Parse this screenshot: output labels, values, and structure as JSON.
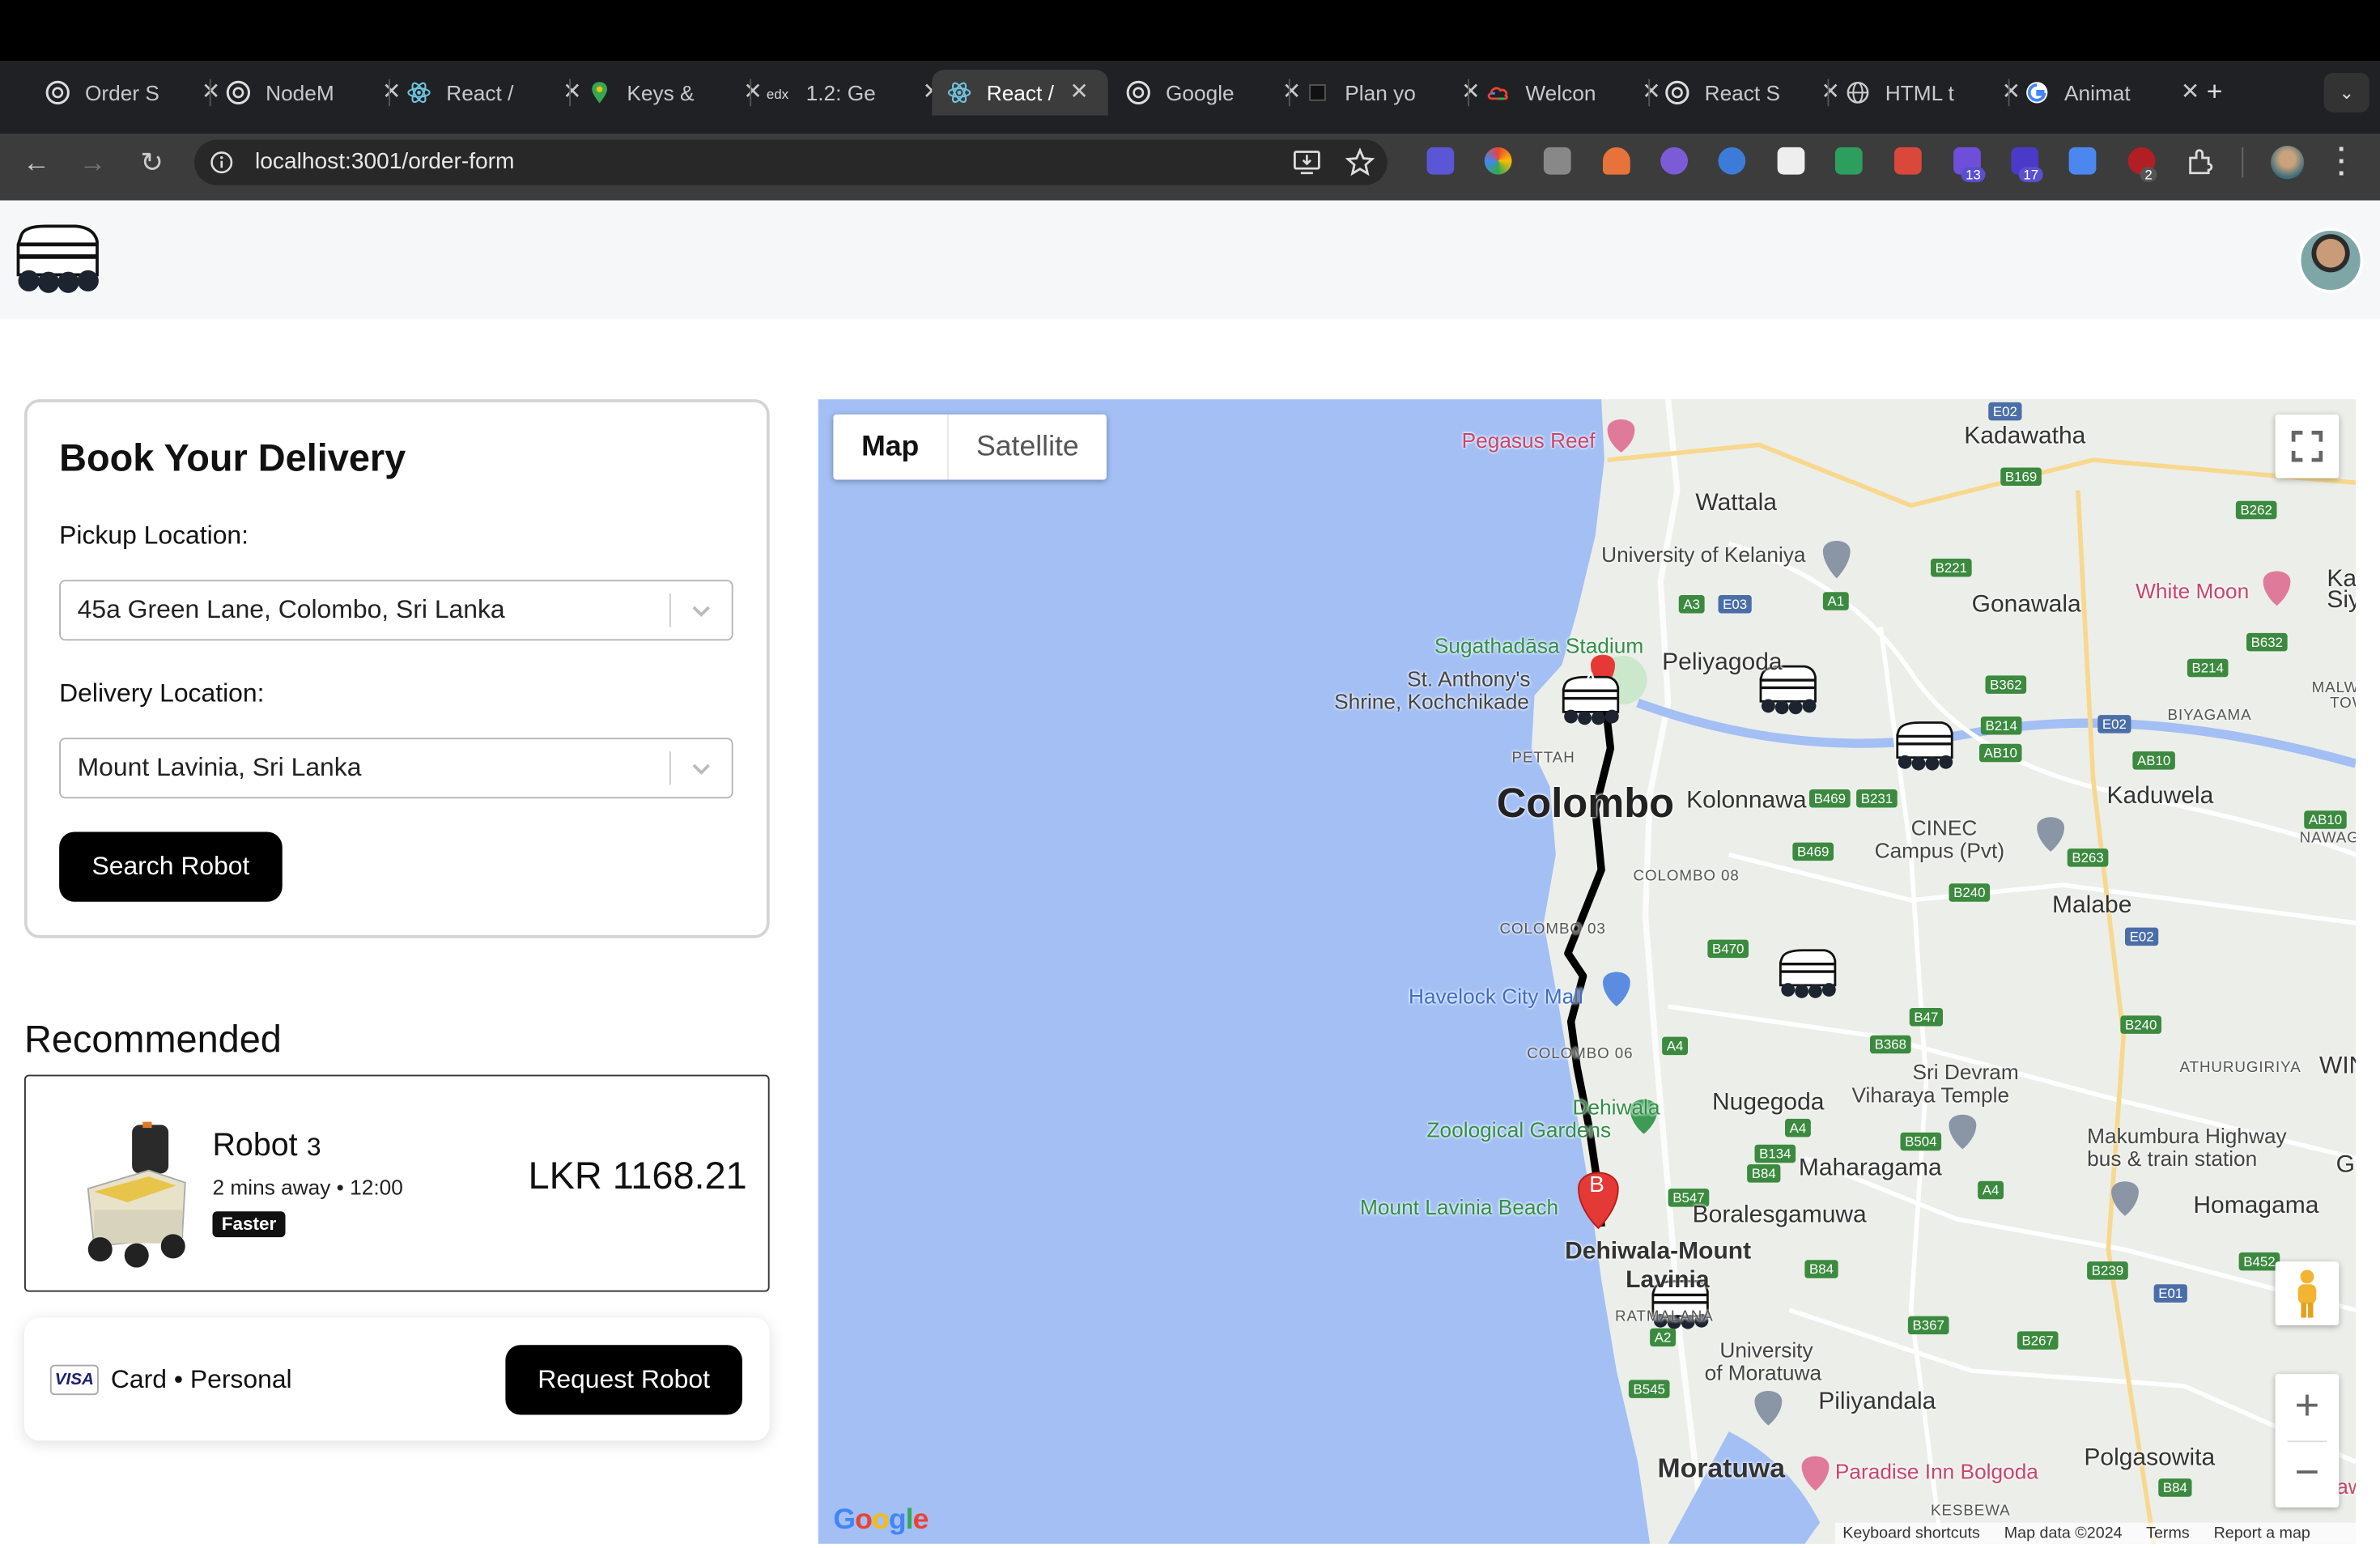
{
  "browser": {
    "tabs": [
      {
        "label": "Order S",
        "icon": "openai-icon",
        "active": false
      },
      {
        "label": "NodeM",
        "icon": "openai-icon",
        "active": false
      },
      {
        "label": "React /",
        "icon": "react-icon",
        "active": false
      },
      {
        "label": "Keys &",
        "icon": "maps-pin-icon",
        "active": false
      },
      {
        "label": "1.2: Ge",
        "icon": "edx-icon",
        "active": false
      },
      {
        "label": "React /",
        "icon": "react-icon",
        "active": true
      },
      {
        "label": "Google",
        "icon": "openai-icon",
        "active": false
      },
      {
        "label": "Plan yo",
        "icon": "notion-icon",
        "active": false
      },
      {
        "label": "Welcon",
        "icon": "cloud-icon",
        "active": false
      },
      {
        "label": "React S",
        "icon": "openai-icon",
        "active": false
      },
      {
        "label": "HTML t",
        "icon": "globe-icon",
        "active": false
      },
      {
        "label": "Animat",
        "icon": "google-icon",
        "active": false
      }
    ],
    "url": "localhost:3001/order-form",
    "extension_badges": [
      "13",
      "17",
      "2"
    ]
  },
  "booking": {
    "title": "Book Your Delivery",
    "pickup_label": "Pickup Location:",
    "pickup_value": "45a Green Lane, Colombo, Sri Lanka",
    "delivery_label": "Delivery Location:",
    "delivery_value": "Mount Lavinia, Sri Lanka",
    "search_button": "Search Robot"
  },
  "recommended": {
    "heading": "Recommended",
    "robot_name": "Robot",
    "robot_count": "3",
    "eta": "2 mins away • 12:00",
    "tag": "Faster",
    "price": "LKR 1168.21"
  },
  "payment": {
    "card_brand": "VISA",
    "method": "Card • Personal",
    "request_button": "Request Robot"
  },
  "map": {
    "map_button": "Map",
    "satellite_button": "Satellite",
    "labels": {
      "kadawatha": "Kadawatha",
      "wattala": "Wattala",
      "pegasus": "Pegasus Reef",
      "kelaniya": "University of Kelaniya",
      "gonawala": "Gonawala",
      "whitemoon": "White Moon",
      "stadium": "Sugathadāsa Stadium",
      "peliyagoda": "Peliyagoda",
      "shrine1": "St. Anthony's",
      "shrine2": "Shrine, Kochchikade",
      "pettah": "PETTAH",
      "colombo": "Colombo",
      "kolonnawa": "Kolonnawa",
      "cinec1": "CINEC",
      "cinec2": "Campus (Pvt)",
      "kaduwela": "Kaduwela",
      "colombo08": "COLOMBO 08",
      "colombo03": "COLOMBO 03",
      "malabe": "Malabe",
      "havelock": "Havelock City Mall",
      "colombo06": "COLOMBO 06",
      "devram1": "Sri Devram",
      "devram2": "Viharaya Temple",
      "dehiwala_zoo1": "Dehiwala",
      "dehiwala_zoo2": "Zoological Gardens",
      "nugegoda": "Nugegoda",
      "athurugiriya": "ATHURUGIRIYA",
      "makumbura1": "Makumbura Highway",
      "makumbura2": "bus & train station",
      "maharagama": "Maharagama",
      "homagama": "Homagama",
      "lavinia_beach": "Mount Lavinia Beach",
      "boralesgamuwa": "Boralesgamuwa",
      "dehiwala1": "Dehiwala-Mount",
      "dehiwala2": "Lavinia",
      "ratmalana": "RATMALANA",
      "moratuwa_uni1": "University",
      "moratuwa_uni2": "of Moratuwa",
      "piliyandala": "Piliyandala",
      "moratuwa": "Moratuwa",
      "paradise": "Paradise Inn Bolgoda",
      "polgasowita": "Polgasowita",
      "kesbewa": "KESBEWA",
      "biyagama": "BIYAGAMA",
      "malwana1": "MALWANA",
      "malwana2": "TOWN",
      "nawagamuwa": "NAWAGAMUW",
      "ka1": "Ka",
      "ka2": "Siy",
      "win": "WIN",
      "go": "Go",
      "saw": "Saw"
    },
    "shields": [
      "E02",
      "B169",
      "B262",
      "B221",
      "A3",
      "E03",
      "A1",
      "B632",
      "B214",
      "B362",
      "E02",
      "B214",
      "AB10",
      "AB10",
      "B469",
      "B231",
      "AB10",
      "B469",
      "B263",
      "B240",
      "E02",
      "B470",
      "B47",
      "B240",
      "A4",
      "B368",
      "A4",
      "B504",
      "A4",
      "B134",
      "B84",
      "B547",
      "B84",
      "B239",
      "B452",
      "E01",
      "A2",
      "B367",
      "B267",
      "B545",
      "B84"
    ],
    "pin_a": "A",
    "pin_b": "B",
    "keyboard": "Keyboard shortcuts",
    "mapdata": "Map data ©2024",
    "terms": "Terms",
    "report": "Report a map error",
    "google": "Google"
  }
}
